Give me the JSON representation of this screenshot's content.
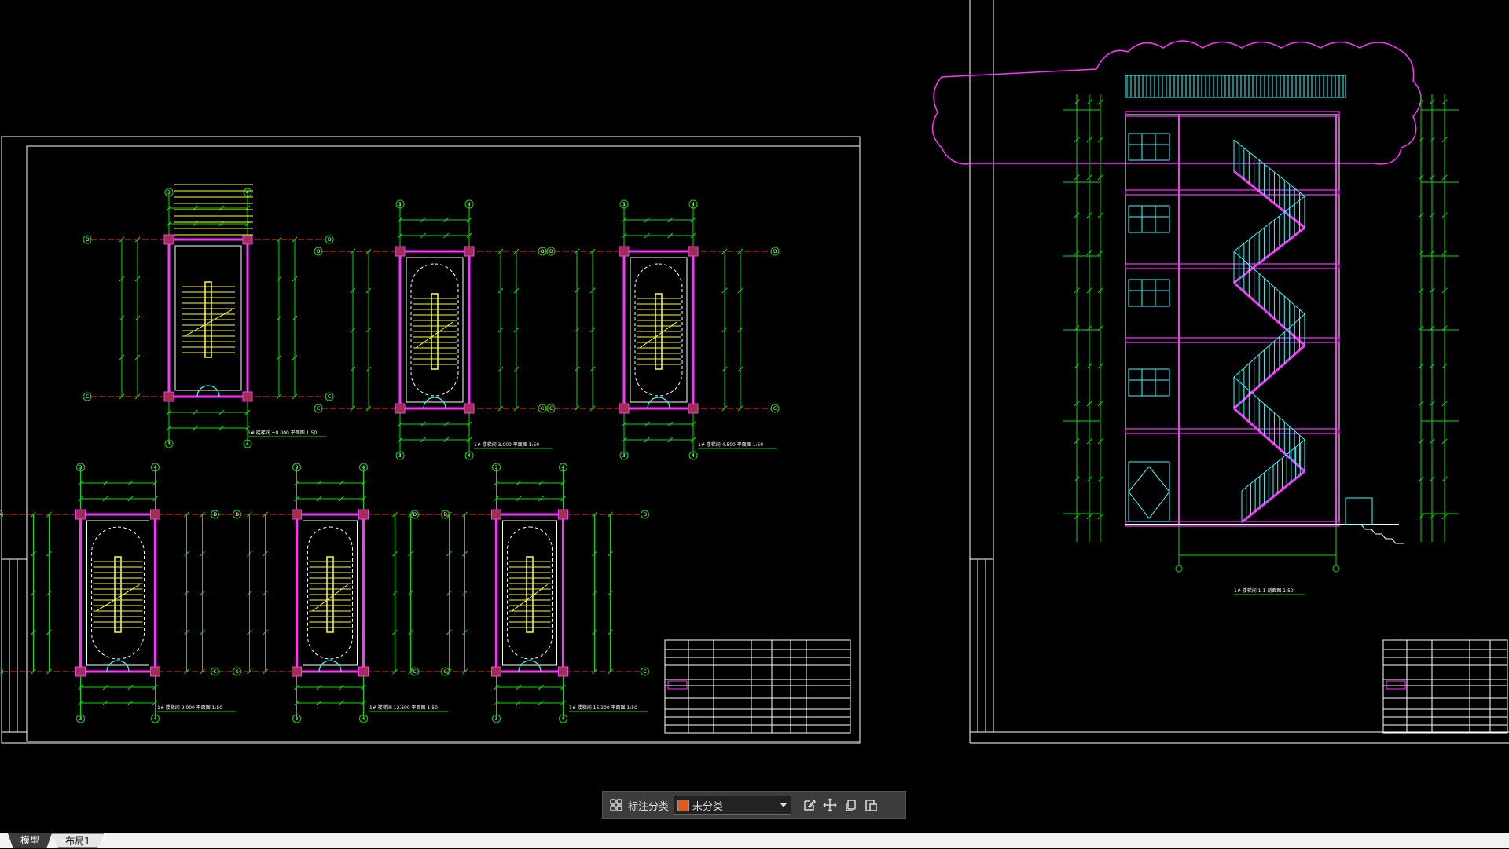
{
  "toolbar": {
    "category_label": "标注分类",
    "selected_category": "未分类",
    "tool_icons": [
      "grid-icon",
      "edit-icon",
      "move-icon",
      "copy-icon",
      "paste-icon"
    ]
  },
  "tabs": [
    {
      "label": "模型",
      "active": true
    },
    {
      "label": "布局1",
      "active": false
    }
  ],
  "drawing": {
    "plan_labels": [
      "1# 楼梯间 ±0.000 平面图 1:50",
      "1# 楼梯间 3.000 平面图 1:50",
      "1# 楼梯间 4.500 平面图 1:50",
      "1# 楼梯间 9.000 平面图 1:50",
      "1# 楼梯间 12.600 平面图 1:50",
      "1# 楼梯间 16.200 平面图 1:50"
    ],
    "section_label": "1# 楼梯间 1-1 剖面图 1:50",
    "axis_letters": [
      "D",
      "C",
      "3",
      "4"
    ]
  },
  "colors": {
    "background": "#000000",
    "dim_green": "#00e000",
    "wall_magenta": "#ff33ff",
    "stair_yellow": "#ffff33",
    "rail_cyan": "#33ffff",
    "frame_white": "#ffffff",
    "axis_red": "#ff3030"
  }
}
